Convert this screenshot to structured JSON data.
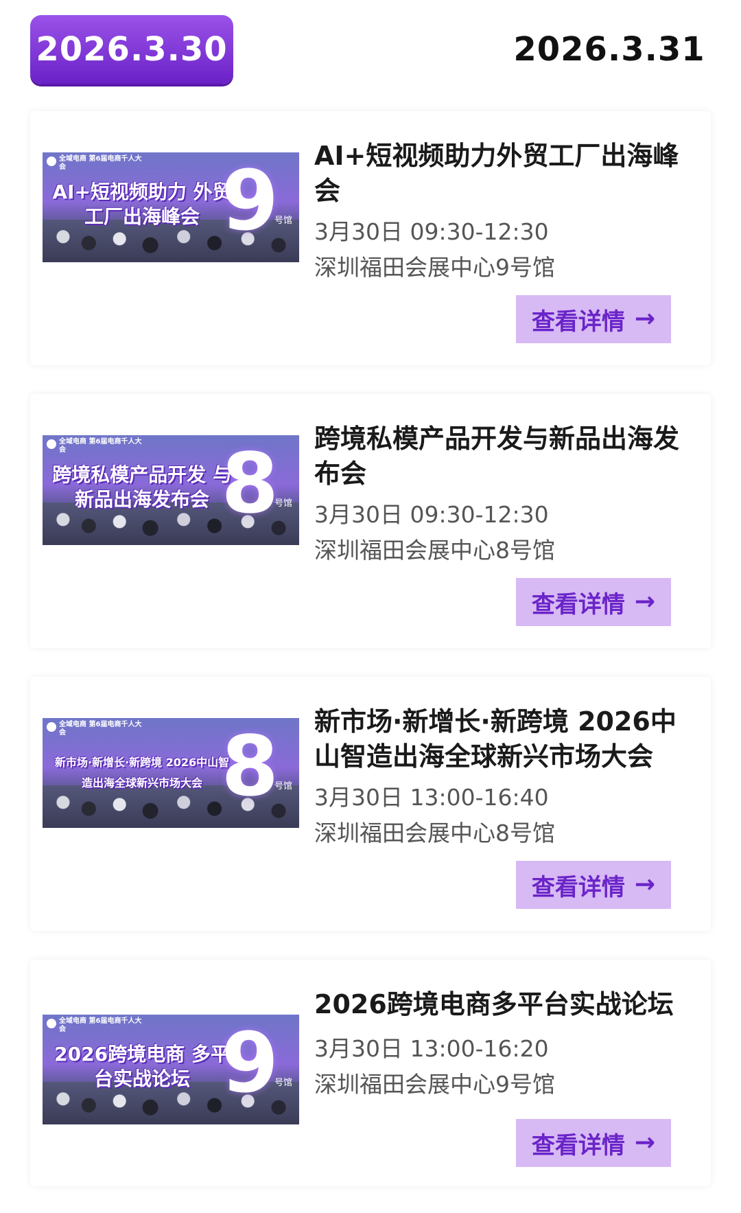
{
  "date_tabs": [
    {
      "label": "2026.3.30",
      "active": true
    },
    {
      "label": "2026.3.31",
      "active": false
    }
  ],
  "colors": {
    "accent": "#7a2fd6",
    "button_bg": "#d7b9f4",
    "button_text": "#6a24c8",
    "meta_text": "#555555"
  },
  "events": [
    {
      "title": "AI+短视频助力外贸工厂出海峰会",
      "time": "3月30日 09:30-12:30",
      "venue": "深圳福田会展中心9号馆",
      "button_label": "查看详情",
      "thumb": {
        "brand": "全域电商 第6届电商千人大会",
        "title": "AI+短视频助力 外贸工厂出海峰会",
        "hall": "9",
        "hall_label": "号馆"
      }
    },
    {
      "title": "跨境私模产品开发与新品出海发布会",
      "time": "3月30日 09:30-12:30",
      "venue": "深圳福田会展中心8号馆",
      "button_label": "查看详情",
      "thumb": {
        "brand": "全域电商 第6届电商千人大会",
        "title": "跨境私模产品开发 与新品出海发布会",
        "hall": "8",
        "hall_label": "号馆"
      }
    },
    {
      "title": "新市场·新增长·新跨境 2026中山智造出海全球新兴市场大会",
      "time": "3月30日 13:00-16:40",
      "venue": "深圳福田会展中心8号馆",
      "button_label": "查看详情",
      "thumb": {
        "brand": "全域电商 第6届电商千人大会",
        "title": "新市场·新增长·新跨境 2026中山智造出海全球新兴市场大会",
        "hall": "8",
        "hall_label": "号馆"
      }
    },
    {
      "title": "2026跨境电商多平台实战论坛",
      "time": "3月30日 13:00-16:20",
      "venue": "深圳福田会展中心9号馆",
      "button_label": "查看详情",
      "thumb": {
        "brand": "全域电商 第6届电商千人大会",
        "title": "2026跨境电商 多平台实战论坛",
        "hall": "9",
        "hall_label": "号馆"
      }
    }
  ]
}
